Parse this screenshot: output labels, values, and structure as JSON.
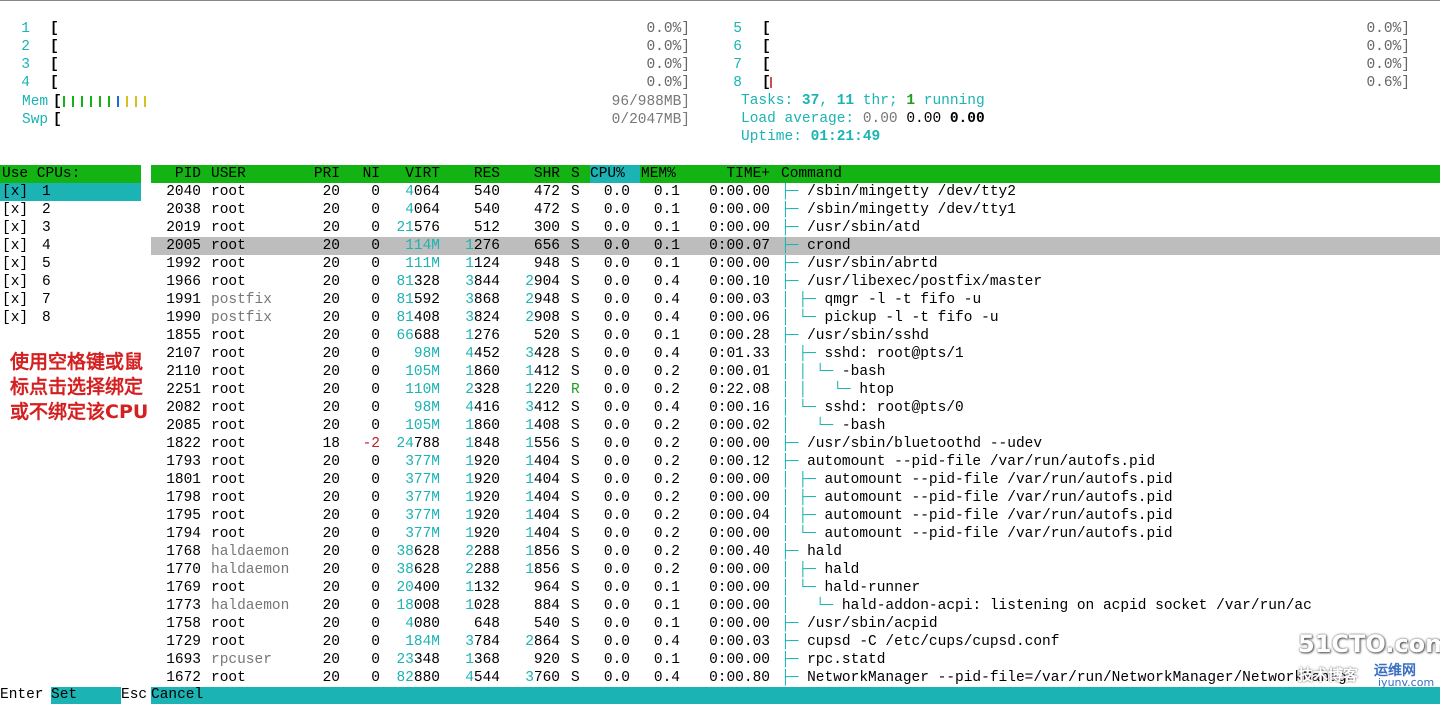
{
  "cpu_meters_left": [
    {
      "num": "1",
      "value": "0.0%]"
    },
    {
      "num": "2",
      "value": "0.0%]"
    },
    {
      "num": "3",
      "value": "0.0%]"
    },
    {
      "num": "4",
      "value": "0.0%]"
    }
  ],
  "cpu_meters_right": [
    {
      "num": "5",
      "value": "0.0%]"
    },
    {
      "num": "6",
      "value": "0.0%]"
    },
    {
      "num": "7",
      "value": "0.0%]"
    },
    {
      "num": "8",
      "value": "0.6%]"
    }
  ],
  "bracket_open": "[",
  "mem": {
    "label": "Mem",
    "value": "96/988MB]"
  },
  "swp": {
    "label": "Swp",
    "value": "0/2047MB]"
  },
  "tasks": {
    "label": "Tasks: ",
    "count": "37",
    "sep": ", ",
    "threads": "11",
    "thr": " thr; ",
    "running": "1",
    "running_label": " running"
  },
  "load": {
    "label": "Load average: ",
    "v1": "0.00",
    "v2": "0.00",
    "v3": "0.00"
  },
  "uptime": {
    "label": "Uptime: ",
    "value": "01:21:49"
  },
  "cpu_panel": {
    "title": "Use CPUs:",
    "box": "[x]",
    "items": [
      "1",
      "2",
      "3",
      "4",
      "5",
      "6",
      "7",
      "8"
    ]
  },
  "columns": {
    "pid": "PID",
    "user": "USER",
    "pri": "PRI",
    "ni": "NI",
    "virt": "VIRT",
    "res": "RES",
    "shr": "SHR",
    "s": "S",
    "cpu": "CPU%",
    "mem": "MEM%",
    "time": "TIME+",
    "command": "Command"
  },
  "processes": [
    {
      "pid": "2040",
      "user": "root",
      "pri": "20",
      "ni": "0",
      "virt": "4064",
      "res": "540",
      "shr": "472",
      "s": "S",
      "cpu": "0.0",
      "mem": "0.1",
      "time": "0:00.00",
      "tree": "├─",
      "cmd": "/sbin/mingetty /dev/tty2"
    },
    {
      "pid": "2038",
      "user": "root",
      "pri": "20",
      "ni": "0",
      "virt": "4064",
      "res": "540",
      "shr": "472",
      "s": "S",
      "cpu": "0.0",
      "mem": "0.1",
      "time": "0:00.00",
      "tree": "├─",
      "cmd": "/sbin/mingetty /dev/tty1"
    },
    {
      "pid": "2019",
      "user": "root",
      "pri": "20",
      "ni": "0",
      "virt": "21576",
      "res": "512",
      "shr": "300",
      "s": "S",
      "cpu": "0.0",
      "mem": "0.1",
      "time": "0:00.00",
      "tree": "├─",
      "cmd": "/usr/sbin/atd"
    },
    {
      "pid": "2005",
      "user": "root",
      "pri": "20",
      "ni": "0",
      "virt": "114M",
      "res": "1276",
      "shr": "656",
      "s": "S",
      "cpu": "0.0",
      "mem": "0.1",
      "time": "0:00.07",
      "tree": "├─",
      "cmd": "crond"
    },
    {
      "pid": "1992",
      "user": "root",
      "pri": "20",
      "ni": "0",
      "virt": "111M",
      "res": "1124",
      "shr": "948",
      "s": "S",
      "cpu": "0.0",
      "mem": "0.1",
      "time": "0:00.00",
      "tree": "├─",
      "cmd": "/usr/sbin/abrtd"
    },
    {
      "pid": "1966",
      "user": "root",
      "pri": "20",
      "ni": "0",
      "virt": "81328",
      "res": "3844",
      "shr": "2904",
      "s": "S",
      "cpu": "0.0",
      "mem": "0.4",
      "time": "0:00.10",
      "tree": "├─",
      "cmd": "/usr/libexec/postfix/master"
    },
    {
      "pid": "1991",
      "user": "postfix",
      "pri": "20",
      "ni": "0",
      "virt": "81592",
      "res": "3868",
      "shr": "2948",
      "s": "S",
      "cpu": "0.0",
      "mem": "0.4",
      "time": "0:00.03",
      "tree": "│ ├─",
      "cmd": "qmgr -l -t fifo -u"
    },
    {
      "pid": "1990",
      "user": "postfix",
      "pri": "20",
      "ni": "0",
      "virt": "81408",
      "res": "3824",
      "shr": "2908",
      "s": "S",
      "cpu": "0.0",
      "mem": "0.4",
      "time": "0:00.06",
      "tree": "│ └─",
      "cmd": "pickup -l -t fifo -u"
    },
    {
      "pid": "1855",
      "user": "root",
      "pri": "20",
      "ni": "0",
      "virt": "66688",
      "res": "1276",
      "shr": "520",
      "s": "S",
      "cpu": "0.0",
      "mem": "0.1",
      "time": "0:00.28",
      "tree": "├─",
      "cmd": "/usr/sbin/sshd"
    },
    {
      "pid": "2107",
      "user": "root",
      "pri": "20",
      "ni": "0",
      "virt": "98M",
      "res": "4452",
      "shr": "3428",
      "s": "S",
      "cpu": "0.0",
      "mem": "0.4",
      "time": "0:01.33",
      "tree": "│ ├─",
      "cmd": "sshd: root@pts/1"
    },
    {
      "pid": "2110",
      "user": "root",
      "pri": "20",
      "ni": "0",
      "virt": "105M",
      "res": "1860",
      "shr": "1412",
      "s": "S",
      "cpu": "0.0",
      "mem": "0.2",
      "time": "0:00.01",
      "tree": "│ │ └─",
      "cmd": "-bash"
    },
    {
      "pid": "2251",
      "user": "root",
      "pri": "20",
      "ni": "0",
      "virt": "110M",
      "res": "2328",
      "shr": "1220",
      "s": "R",
      "cpu": "0.0",
      "mem": "0.2",
      "time": "0:22.08",
      "tree": "│ │   └─",
      "cmd": "htop"
    },
    {
      "pid": "2082",
      "user": "root",
      "pri": "20",
      "ni": "0",
      "virt": "98M",
      "res": "4416",
      "shr": "3412",
      "s": "S",
      "cpu": "0.0",
      "mem": "0.4",
      "time": "0:00.16",
      "tree": "│ └─",
      "cmd": "sshd: root@pts/0"
    },
    {
      "pid": "2085",
      "user": "root",
      "pri": "20",
      "ni": "0",
      "virt": "105M",
      "res": "1860",
      "shr": "1408",
      "s": "S",
      "cpu": "0.0",
      "mem": "0.2",
      "time": "0:00.02",
      "tree": "│   └─",
      "cmd": "-bash"
    },
    {
      "pid": "1822",
      "user": "root",
      "pri": "18",
      "ni": "-2",
      "virt": "24788",
      "res": "1848",
      "shr": "1556",
      "s": "S",
      "cpu": "0.0",
      "mem": "0.2",
      "time": "0:00.00",
      "tree": "├─",
      "cmd": "/usr/sbin/bluetoothd --udev"
    },
    {
      "pid": "1793",
      "user": "root",
      "pri": "20",
      "ni": "0",
      "virt": "377M",
      "res": "1920",
      "shr": "1404",
      "s": "S",
      "cpu": "0.0",
      "mem": "0.2",
      "time": "0:00.12",
      "tree": "├─",
      "cmd": "automount --pid-file /var/run/autofs.pid"
    },
    {
      "pid": "1801",
      "user": "root",
      "pri": "20",
      "ni": "0",
      "virt": "377M",
      "res": "1920",
      "shr": "1404",
      "s": "S",
      "cpu": "0.0",
      "mem": "0.2",
      "time": "0:00.00",
      "tree": "│ ├─",
      "cmd": "automount --pid-file /var/run/autofs.pid"
    },
    {
      "pid": "1798",
      "user": "root",
      "pri": "20",
      "ni": "0",
      "virt": "377M",
      "res": "1920",
      "shr": "1404",
      "s": "S",
      "cpu": "0.0",
      "mem": "0.2",
      "time": "0:00.00",
      "tree": "│ ├─",
      "cmd": "automount --pid-file /var/run/autofs.pid"
    },
    {
      "pid": "1795",
      "user": "root",
      "pri": "20",
      "ni": "0",
      "virt": "377M",
      "res": "1920",
      "shr": "1404",
      "s": "S",
      "cpu": "0.0",
      "mem": "0.2",
      "time": "0:00.04",
      "tree": "│ ├─",
      "cmd": "automount --pid-file /var/run/autofs.pid"
    },
    {
      "pid": "1794",
      "user": "root",
      "pri": "20",
      "ni": "0",
      "virt": "377M",
      "res": "1920",
      "shr": "1404",
      "s": "S",
      "cpu": "0.0",
      "mem": "0.2",
      "time": "0:00.00",
      "tree": "│ └─",
      "cmd": "automount --pid-file /var/run/autofs.pid"
    },
    {
      "pid": "1768",
      "user": "haldaemon",
      "pri": "20",
      "ni": "0",
      "virt": "38628",
      "res": "2288",
      "shr": "1856",
      "s": "S",
      "cpu": "0.0",
      "mem": "0.2",
      "time": "0:00.40",
      "tree": "├─",
      "cmd": "hald"
    },
    {
      "pid": "1770",
      "user": "haldaemon",
      "pri": "20",
      "ni": "0",
      "virt": "38628",
      "res": "2288",
      "shr": "1856",
      "s": "S",
      "cpu": "0.0",
      "mem": "0.2",
      "time": "0:00.00",
      "tree": "│ ├─",
      "cmd": "hald"
    },
    {
      "pid": "1769",
      "user": "root",
      "pri": "20",
      "ni": "0",
      "virt": "20400",
      "res": "1132",
      "shr": "964",
      "s": "S",
      "cpu": "0.0",
      "mem": "0.1",
      "time": "0:00.00",
      "tree": "│ └─",
      "cmd": "hald-runner"
    },
    {
      "pid": "1773",
      "user": "haldaemon",
      "pri": "20",
      "ni": "0",
      "virt": "18008",
      "res": "1028",
      "shr": "884",
      "s": "S",
      "cpu": "0.0",
      "mem": "0.1",
      "time": "0:00.00",
      "tree": "│   └─",
      "cmd": "hald-addon-acpi: listening on acpid socket /var/run/ac"
    },
    {
      "pid": "1758",
      "user": "root",
      "pri": "20",
      "ni": "0",
      "virt": "4080",
      "res": "648",
      "shr": "540",
      "s": "S",
      "cpu": "0.0",
      "mem": "0.1",
      "time": "0:00.00",
      "tree": "├─",
      "cmd": "/usr/sbin/acpid"
    },
    {
      "pid": "1729",
      "user": "root",
      "pri": "20",
      "ni": "0",
      "virt": "184M",
      "res": "3784",
      "shr": "2864",
      "s": "S",
      "cpu": "0.0",
      "mem": "0.4",
      "time": "0:00.03",
      "tree": "├─",
      "cmd": "cupsd -C /etc/cups/cupsd.conf"
    },
    {
      "pid": "1693",
      "user": "rpcuser",
      "pri": "20",
      "ni": "0",
      "virt": "23348",
      "res": "1368",
      "shr": "920",
      "s": "S",
      "cpu": "0.0",
      "mem": "0.1",
      "time": "0:00.00",
      "tree": "├─",
      "cmd": "rpc.statd"
    },
    {
      "pid": "1672",
      "user": "root",
      "pri": "20",
      "ni": "0",
      "virt": "82880",
      "res": "4544",
      "shr": "3760",
      "s": "S",
      "cpu": "0.0",
      "mem": "0.4",
      "time": "0:00.80",
      "tree": "├─",
      "cmd": "NetworkManager --pid-file=/var/run/NetworkManager/NetworkManage"
    }
  ],
  "annotation": "使用空格键或鼠标点击选择绑定或不绑定该CPU",
  "footer": {
    "enter_key": "Enter",
    "enter_label": "Set",
    "esc_key": "Esc",
    "esc_label": "Cancel"
  },
  "watermark": {
    "top": "51CTO.com",
    "bottom": "技术博客",
    "brand": "运维网",
    "url": "iyunv.com"
  },
  "colors": {
    "cyan": "#1bb3b3",
    "green": "#14b314",
    "selected_row": "#bdbdbd",
    "annotation": "#d42020"
  },
  "meters": {
    "cpu_ticks": [
      0,
      0,
      0,
      0,
      0,
      0,
      0,
      1
    ],
    "mem_ticks": 10
  }
}
